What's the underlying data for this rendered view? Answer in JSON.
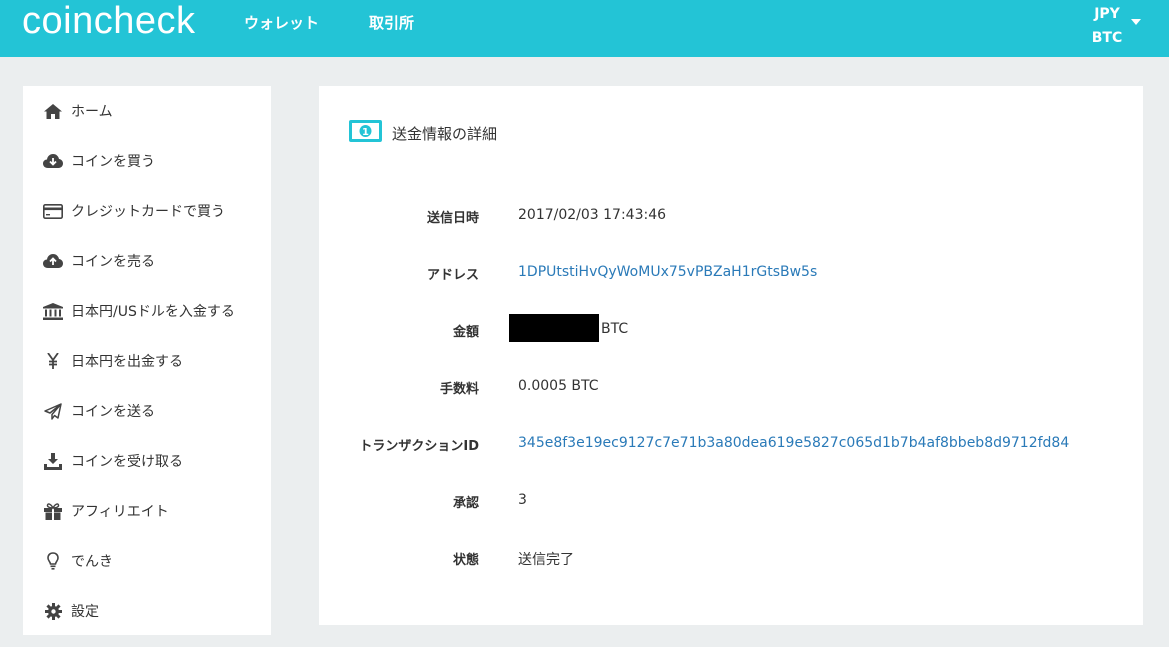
{
  "header": {
    "logo": "coincheck",
    "nav": [
      {
        "label": "ウォレット"
      },
      {
        "label": "取引所"
      }
    ],
    "currencies": [
      "JPY",
      "BTC"
    ]
  },
  "sidebar": {
    "items": [
      {
        "label": "ホーム",
        "icon": "home-icon"
      },
      {
        "label": "コインを買う",
        "icon": "cloud-download-icon"
      },
      {
        "label": "クレジットカードで買う",
        "icon": "credit-card-icon"
      },
      {
        "label": "コインを売る",
        "icon": "cloud-upload-icon"
      },
      {
        "label": "日本円/USドルを入金する",
        "icon": "bank-icon"
      },
      {
        "label": "日本円を出金する",
        "icon": "yen-icon"
      },
      {
        "label": "コインを送る",
        "icon": "paper-plane-icon"
      },
      {
        "label": "コインを受け取る",
        "icon": "download-icon"
      },
      {
        "label": "アフィリエイト",
        "icon": "gift-icon"
      },
      {
        "label": "でんき",
        "icon": "lightbulb-icon"
      },
      {
        "label": "設定",
        "icon": "gear-icon"
      }
    ]
  },
  "panel": {
    "title": "送金情報の詳細",
    "title_icon": "money-bill-icon",
    "rows": [
      {
        "label": "送信日時",
        "value": "2017/02/03 17:43:46"
      },
      {
        "label": "アドレス",
        "value": "1DPUtstiHvQyWoMUx75vPBZaH1rGtsBw5s"
      },
      {
        "label": "金額",
        "value": "BTC"
      },
      {
        "label": "手数料",
        "value": "0.0005 BTC"
      },
      {
        "label": "トランザクションID",
        "value": "345e8f3e19ec9127c7e71b3a80dea619e5827c065d1b7b4af8bbeb8d9712fd84"
      },
      {
        "label": "承認",
        "value": "3"
      },
      {
        "label": "状態",
        "value": "送信完了"
      }
    ]
  },
  "colors": {
    "header_bg": "#23c4d6",
    "page_bg": "#ebeeef",
    "link": "#2a7ab8"
  }
}
